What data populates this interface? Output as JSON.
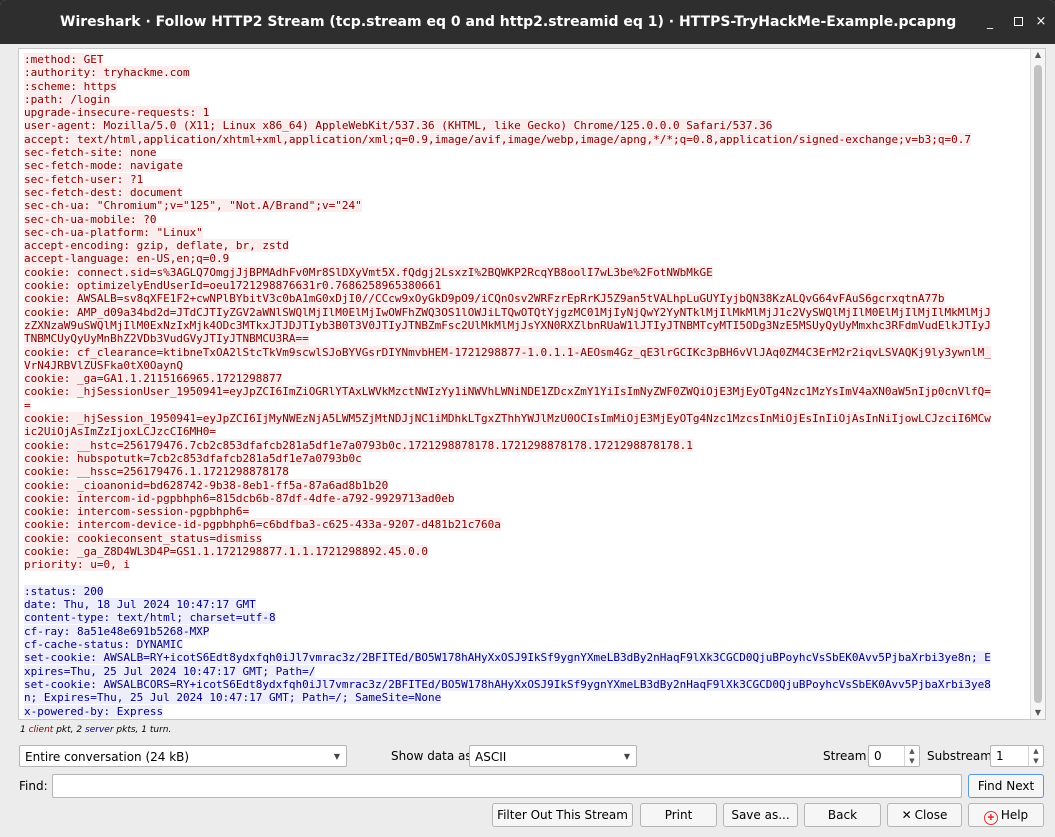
{
  "window": {
    "title": "Wireshark · Follow HTTP2 Stream (tcp.stream eq 0 and http2.streamid eq 1) · HTTPS-TryHackMe-Example.pcapng",
    "minimize": "_",
    "close": "×"
  },
  "client_lines": [
    ":method: GET",
    ":authority: tryhackme.com",
    ":scheme: https",
    ":path: /login",
    "upgrade-insecure-requests: 1",
    "user-agent: Mozilla/5.0 (X11; Linux x86_64) AppleWebKit/537.36 (KHTML, like Gecko) Chrome/125.0.0.0 Safari/537.36",
    "accept: text/html,application/xhtml+xml,application/xml;q=0.9,image/avif,image/webp,image/apng,*/*;q=0.8,application/signed-exchange;v=b3;q=0.7",
    "sec-fetch-site: none",
    "sec-fetch-mode: navigate",
    "sec-fetch-user: ?1",
    "sec-fetch-dest: document",
    "sec-ch-ua: \"Chromium\";v=\"125\", \"Not.A/Brand\";v=\"24\"",
    "sec-ch-ua-mobile: ?0",
    "sec-ch-ua-platform: \"Linux\"",
    "accept-encoding: gzip, deflate, br, zstd",
    "accept-language: en-US,en;q=0.9",
    "cookie: connect.sid=s%3AGLQ7OmgjJjBPMAdhFv0Mr8SlDXyVmt5X.fQdgj2LsxzI%2BQWKP2RcqYB8oolI7wL3be%2FotNWbMkGE",
    "cookie: optimizelyEndUserId=oeu1721298876631r0.7686258965380661",
    "cookie: AWSALB=sv8qXFE1F2+cwNPlBYbitV3c0bA1mG0xDjI0//CCcw9xOyGkD9pO9/iCQnOsv2WRFzrEpRrKJ5Z9an5tVALhpLuGUYIyjbQN38KzALQvG64vFAuS6gcrxqtnA77b",
    "cookie: AMP_d09a34bd2d=JTdCJTIyZGV2aWNlSWQlMjIlM0ElMjIwOWFhZWQ3OS1lOWJiLTQwOTQtYjgzMC01MjIyNjQwY2YyNTklMjIlMkMlMjJ1c2VySWQlMjIlM0ElMjIlMjIlMkMlMjJ",
    "zZXNzaW9uSWQlMjIlM0ExNzIxMjk4ODc3MTkxJTJDJTIyb3B0T3V0JTIyJTNBZmFsc2UlMkMlMjJsYXN0RXZlbnRUaW1lJTIyJTNBMTcyMTI5ODg3NzE5MSUyQyUyMmxhc3RFdmVudElkJTIyJ",
    "TNBMCUyQyUyMnBhZ2VDb3VudGVyJTIyJTNBMCU3RA==",
    "cookie: cf_clearance=ktibneTxOA2lStcTkVm9scwlSJoBYVGsrDIYNmvbHEM-1721298877-1.0.1.1-AEOsm4Gz_qE3lrGCIKc3pBH6vVlJAq0ZM4C3ErM2r2iqvLSVAQKj9ly3ywnlM_",
    "VrN4JRBVlZUSFka0tX0OaynQ",
    "cookie: _ga=GA1.1.2115166965.1721298877",
    "cookie: _hjSessionUser_1950941=eyJpZCI6ImZiOGRlYTAxLWVkMzctNWIzYy1iNWVhLWNiNDE1ZDcxZmY1YiIsImNyZWF0ZWQiOjE3MjEyOTg4Nzc1MzYsImV4aXN0aW5nIjp0cnVlfQ=",
    "=",
    "cookie: _hjSession_1950941=eyJpZCI6IjMyNWEzNjA5LWM5ZjMtNDJjNC1iMDhkLTgxZThhYWJlMzU0OCIsImMiOjE3MjEyOTg4Nzc1MzcsInMiOjEsInIiOjAsInNiIjowLCJzciI6MCw",
    "ic2UiOjAsImZzIjoxLCJzcCI6MH0=",
    "cookie: __hstc=256179476.7cb2c853dfafcb281a5df1e7a0793b0c.1721298878178.1721298878178.1721298878178.1",
    "cookie: hubspotutk=7cb2c853dfafcb281a5df1e7a0793b0c",
    "cookie: __hssc=256179476.1.1721298878178",
    "cookie: _cioanonid=bd628742-9b38-8eb1-ff5a-87a6ad8b1b20",
    "cookie: intercom-id-pgpbhph6=815dcb6b-87df-4dfe-a792-9929713ad0eb",
    "cookie: intercom-session-pgpbhph6=",
    "cookie: intercom-device-id-pgpbhph6=c6bdfba3-c625-433a-9207-d481b21c760a",
    "cookie: cookieconsent_status=dismiss",
    "cookie: _ga_Z8D4WL3D4P=GS1.1.1721298877.1.1.1721298892.45.0.0",
    "priority: u=0, i"
  ],
  "server_lines": [
    ":status: 200",
    "date: Thu, 18 Jul 2024 10:47:17 GMT",
    "content-type: text/html; charset=utf-8",
    "cf-ray: 8a51e48e691b5268-MXP",
    "cf-cache-status: DYNAMIC",
    "set-cookie: AWSALB=RY+icotS6Edt8ydxfqh0iJl7vmrac3z/2BFITEd/BO5W178hAHyXxOSJ9IkSf9ygnYXmeLB3dBy2nHaqF9lXk3CGCD0QjuBPoyhcVsSbEK0Avv5PjbaXrbi3ye8n; E",
    "xpires=Thu, 25 Jul 2024 10:47:17 GMT; Path=/",
    "set-cookie: AWSALBCORS=RY+icotS6Edt8ydxfqh0iJl7vmrac3z/2BFITEd/BO5W178hAHyXxOSJ9IkSf9ygnYXmeLB3dBy2nHaqF9lXk3CGCD0QjuBPoyhcVsSbEK0Avv5PjbaXrbi3ye8",
    "n; Expires=Thu, 25 Jul 2024 10:47:17 GMT; Path=/; SameSite=None",
    "x-powered-by: Express"
  ],
  "summary": {
    "client_count": "1",
    "client_word": "client",
    "pkt_text": "pkt,",
    "server_count": "2",
    "server_word": "server",
    "pkts_text": "pkts, 1 turn."
  },
  "controls": {
    "conversation_value": "Entire conversation (24 kB)",
    "show_data_label": "Show data as",
    "show_data_value": "ASCII",
    "stream_label": "Stream",
    "stream_value": "0",
    "substream_label": "Substream",
    "substream_value": "1",
    "find_label": "Find:",
    "find_value": "",
    "find_next_label": "Find Next"
  },
  "buttons": {
    "filter_out": "Filter Out This Stream",
    "print": "Print",
    "save_as": "Save as...",
    "back": "Back",
    "close": "Close",
    "help": "Help"
  }
}
